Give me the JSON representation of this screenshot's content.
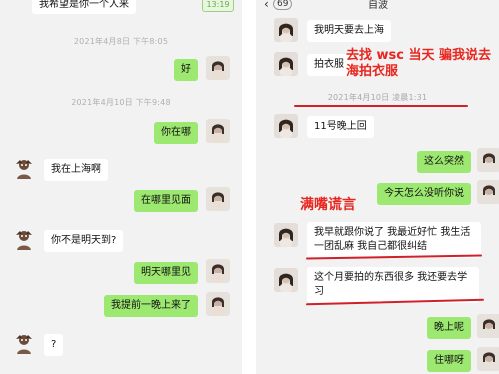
{
  "left": {
    "top_cut_message": "我希望是你一个人来",
    "top_cut_button": "13:19",
    "timestamps": [
      "2021年4月8日 下午8:05",
      "2021年4月10日 下午9:48"
    ],
    "messages": [
      {
        "side": "out",
        "text": "好"
      },
      {
        "side": "out",
        "text": "你在哪"
      },
      {
        "side": "in",
        "text": "我在上海啊"
      },
      {
        "side": "out",
        "text": "在哪里见面"
      },
      {
        "side": "in",
        "text": "你不是明天到?"
      },
      {
        "side": "out",
        "text": "明天哪里见"
      },
      {
        "side": "out",
        "text": "我提前一晚上来了"
      },
      {
        "side": "in",
        "text": "?"
      }
    ]
  },
  "right": {
    "header_count": "69",
    "header_name": "自波",
    "timestamp": "2021年4月10日 凌晨1:31",
    "messages": [
      {
        "side": "in",
        "text": "我明天要去上海"
      },
      {
        "side": "in",
        "text": "拍衣服"
      },
      {
        "side": "in",
        "text": "11号晚上回"
      },
      {
        "side": "out",
        "text": "这么突然"
      },
      {
        "side": "out",
        "text": "今天怎么没听你说"
      },
      {
        "side": "in",
        "text": "我早就跟你说了 我最近好忙 我生活一团乱麻 我自己都很纠结"
      },
      {
        "side": "in",
        "text": "这个月要拍的东西很多 我还要去学习"
      },
      {
        "side": "out",
        "text": "晚上呢"
      },
      {
        "side": "out",
        "text": "住哪呀"
      }
    ],
    "annotations": [
      "去找 wsc 当天 骗我说去海拍衣服",
      "满嘴谎言"
    ]
  },
  "colors": {
    "bubble_out": "#9de870",
    "bubble_in": "#ffffff",
    "annotation": "#e8261f",
    "background": "#f2f2f2"
  }
}
